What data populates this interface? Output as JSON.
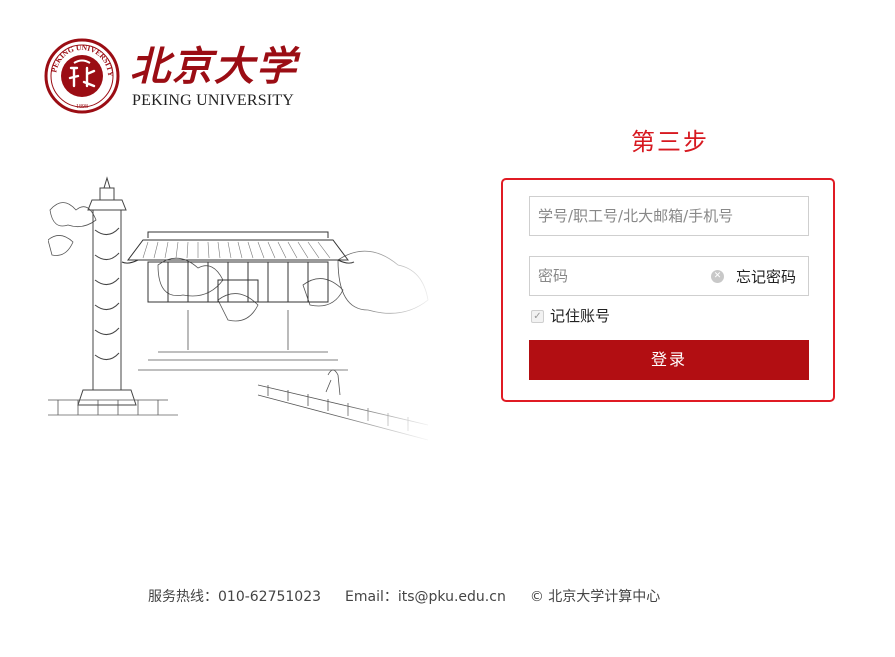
{
  "header": {
    "logo_cn": "北京大学",
    "logo_en": "PEKING UNIVERSITY",
    "seal_text": "PEKING UNIVERSITY 1898"
  },
  "step": {
    "title": "第三步"
  },
  "login": {
    "username_placeholder": "学号/职工号/北大邮箱/手机号",
    "username_value": "",
    "password_placeholder": "密码",
    "password_value": "",
    "forgot_label": "忘记密码",
    "remember_label": "记住账号",
    "remember_checked": true,
    "submit_label": "登录"
  },
  "footer": {
    "hotline": "服务热线：010-62751023",
    "email": "Email：its@pku.edu.cn",
    "copyright": "© 北京大学计算中心"
  },
  "colors": {
    "accent_red": "#d71920",
    "button_red": "#b20e12",
    "brand_red": "#9b0d14"
  },
  "icons": [
    "pku-seal-icon",
    "clear-icon",
    "check-icon"
  ]
}
